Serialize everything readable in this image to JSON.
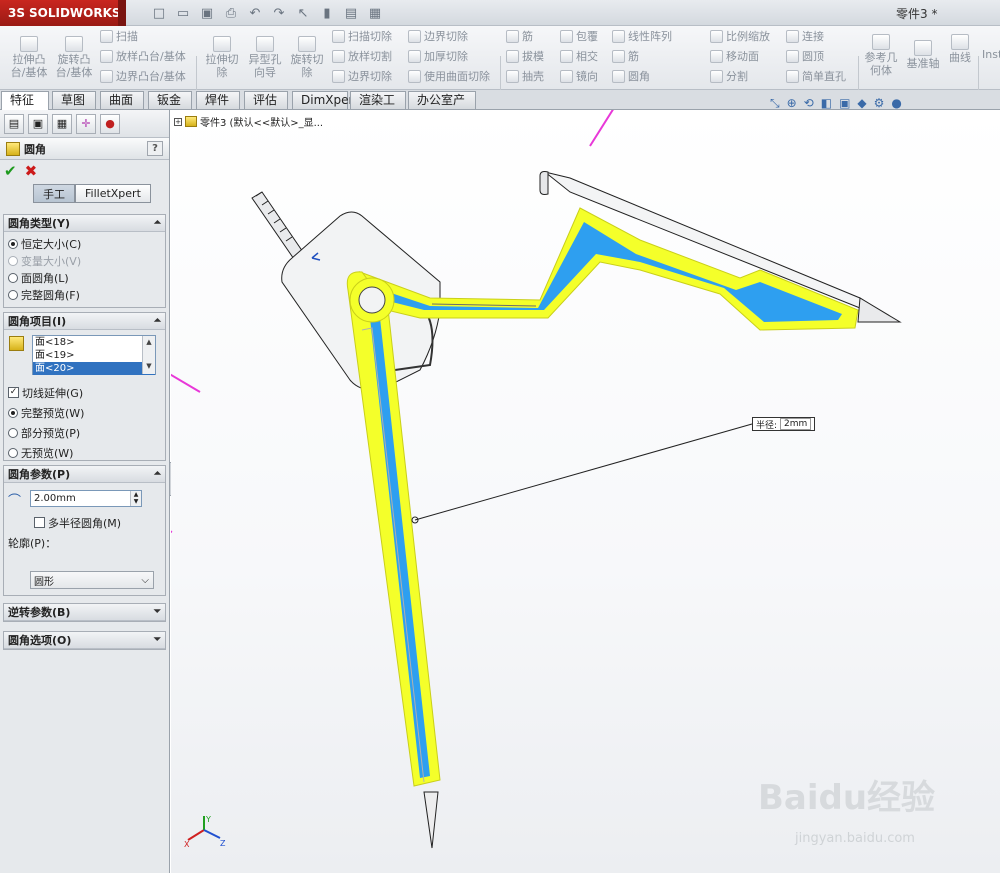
{
  "app": {
    "logo_text": "SOLIDWORKS",
    "logo_prefix": "3S",
    "doc_title": "零件3 *"
  },
  "ribbon": {
    "big_buttons": [
      "拉伸凸\n台/基体",
      "旋转凸\n台/基体",
      "拉伸切\n除",
      "异型孔\n向导",
      "旋转切\n除",
      "参考几\n何体",
      "基准轴",
      "曲线",
      "Inst"
    ],
    "small_buttons": [
      "扫描",
      "放样凸台/基体",
      "边界凸台/基体",
      "扫描切除",
      "放样切割",
      "边界切除",
      "边界切除",
      "加厚切除",
      "使用曲面切除",
      "筋",
      "拔模",
      "抽壳",
      "包覆",
      "相交",
      "镜向",
      "线性阵列",
      "筋",
      "圆角",
      "比例缩放",
      "移动面",
      "分割",
      "连接",
      "圆顶",
      "简单直孔"
    ]
  },
  "tabs": [
    "特征",
    "草图",
    "曲面",
    "钣金",
    "焊件",
    "评估",
    "DimXpert",
    "渲染工具",
    "办公室产品"
  ],
  "tree_path": "零件3  (默认<<默认>_显...",
  "property_manager": {
    "title": "圆角",
    "help": "?",
    "modes": [
      "手工",
      "FilletXpert"
    ],
    "fillet_type": {
      "header": "圆角类型(Y)",
      "options": [
        {
          "label": "恒定大小(C)",
          "selected": true,
          "disabled": false
        },
        {
          "label": "变量大小(V)",
          "selected": false,
          "disabled": true
        },
        {
          "label": "面圆角(L)",
          "selected": false,
          "disabled": false
        },
        {
          "label": "完整圆角(F)",
          "selected": false,
          "disabled": false
        }
      ]
    },
    "fillet_items": {
      "header": "圆角项目(I)",
      "items": [
        "面<18>",
        "面<19>",
        "面<20>"
      ],
      "tangent_propagation": "切线延伸(G)",
      "previews": [
        {
          "label": "完整预览(W)",
          "selected": true
        },
        {
          "label": "部分预览(P)",
          "selected": false
        },
        {
          "label": "无预览(W)",
          "selected": false
        }
      ]
    },
    "fillet_params": {
      "header": "圆角参数(P)",
      "radius": "2.00mm",
      "multi_radius": "多半径圆角(M)",
      "profile_label": "轮廓(P)：",
      "profile_value": "圆形"
    },
    "setback_params": "逆转参数(B)",
    "fillet_options": "圆角选项(O)"
  },
  "viewport": {
    "dimension_label": "半径:",
    "dimension_value": "2mm",
    "triad": {
      "x": "X",
      "y": "Y",
      "z": "Z"
    },
    "watermark": "Baidu经验",
    "watermark_sub": "jingyan.baidu.com"
  },
  "colors": {
    "accent_blue": "#3aa0f0",
    "highlight_yellow": "#f4ff2a",
    "arrow_magenta": "#e838d8"
  }
}
